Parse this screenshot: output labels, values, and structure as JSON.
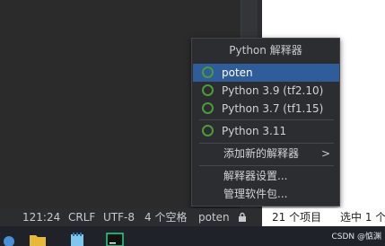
{
  "popup": {
    "title": "Python 解释器",
    "interpreters": [
      {
        "label": "poten",
        "selected": true,
        "icon": "interpreter-ring-icon"
      },
      {
        "label": "Python 3.9 (tf2.10)",
        "selected": false,
        "icon": "interpreter-ring-icon"
      },
      {
        "label": "Python 3.7 (tf1.15)",
        "selected": false,
        "icon": "interpreter-ring-icon"
      },
      {
        "label": "Python 3.11",
        "selected": false,
        "icon": "interpreter-ring-icon"
      }
    ],
    "add_new": "添加新的解释器",
    "settings": "解释器设置...",
    "manage_packages": "管理软件包...",
    "submenu_arrow": ">"
  },
  "status_bar": {
    "position": "121:24",
    "line_separator": "CRLF",
    "encoding": "UTF-8",
    "indent": "4 个空格",
    "interpreter": "poten",
    "lock_icon": "lock-icon"
  },
  "explorer_status": {
    "items": "21 个项目",
    "selected": "选中 1 个"
  },
  "watermark": "CSDN @惦渊",
  "colors": {
    "accent": "#2f5d99",
    "interpreter_ring": "#4e9a3a"
  }
}
